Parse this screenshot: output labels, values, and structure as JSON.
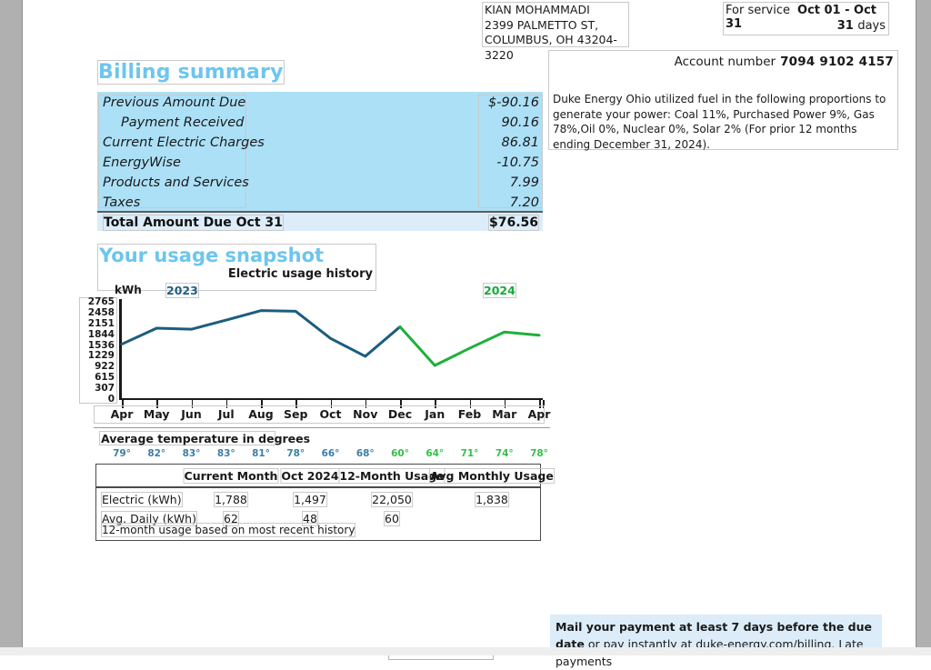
{
  "customer": {
    "name": "KIAN MOHAMMADI",
    "street": "2399 PALMETTO ST,",
    "city_state_zip": "COLUMBUS, OH 43204-3220"
  },
  "service": {
    "label": "For service",
    "period": "Oct 01 - Oct 31",
    "days": "31",
    "days_label": "days"
  },
  "account": {
    "label": "Account number",
    "number": "7094 9102 4157",
    "fuel_mix_text": "Duke Energy Ohio utilized fuel in the following proportions to generate your power: Coal 11%, Purchased Power 9%, Gas 78%,Oil 0%, Nuclear 0%, Solar 2% (For prior 12 months ending December 31, 2024)."
  },
  "billing_summary": {
    "title": "Billing summary",
    "rows": [
      {
        "label": "Previous Amount Due",
        "amount": "$-90.16",
        "indent": false
      },
      {
        "label": "Payment Received",
        "amount": "90.16",
        "indent": true
      },
      {
        "label": "Current Electric Charges",
        "amount": "86.81",
        "indent": false
      },
      {
        "label": "EnergyWise",
        "amount": "-10.75",
        "indent": false
      },
      {
        "label": "Products and Services",
        "amount": "7.99",
        "indent": false
      },
      {
        "label": "Taxes",
        "amount": "7.20",
        "indent": false
      }
    ],
    "total_label": "Total Amount Due Oct 31",
    "total_amount": "$76.56",
    "band_color": "#ace0f7",
    "total_color": "#dcedf9",
    "heading_color": "#6cc6ee"
  },
  "usage_snapshot": {
    "title": "Your usage snapshot",
    "subtitle": "Electric usage history",
    "unit_label": "kWh",
    "legend": [
      {
        "label": "2023",
        "color": "#1f5f86"
      },
      {
        "label": "2024",
        "color": "#19a83a"
      }
    ],
    "temperature_title": "Average temperature in degrees",
    "temperatures": [
      {
        "value": "79°",
        "year": "2023"
      },
      {
        "value": "82°",
        "year": "2023"
      },
      {
        "value": "83°",
        "year": "2023"
      },
      {
        "value": "83°",
        "year": "2023"
      },
      {
        "value": "81°",
        "year": "2023"
      },
      {
        "value": "78°",
        "year": "2023"
      },
      {
        "value": "66°",
        "year": "2023"
      },
      {
        "value": "68°",
        "year": "2023"
      },
      {
        "value": "60°",
        "year": "2024"
      },
      {
        "value": "64°",
        "year": "2024"
      },
      {
        "value": "71°",
        "year": "2024"
      },
      {
        "value": "74°",
        "year": "2024"
      },
      {
        "value": "78°",
        "year": "2024"
      }
    ]
  },
  "usage_table": {
    "headers": [
      "",
      "Current Month",
      "Oct 2024",
      "12-Month Usage",
      "Avg Monthly Usage"
    ],
    "rows": [
      {
        "label": "Electric (kWh)",
        "current_month": "1,788",
        "prior_year": "1,497",
        "twelve_month": "22,050",
        "avg_monthly": "1,838"
      },
      {
        "label": "Avg. Daily (kWh)",
        "current_month": "62",
        "prior_year": "48",
        "twelve_month": "60",
        "avg_monthly": ""
      }
    ],
    "footnote": "12-month usage based on most recent history"
  },
  "footer_message": {
    "bold_part": "Mail your payment at least 7 days before the due date",
    "rest_part": " or pay instantly at duke-energy.com/billing. Late payments"
  },
  "chart_data": {
    "type": "line",
    "title": "Electric usage history",
    "xlabel": "",
    "ylabel": "kWh",
    "ylim": [
      0,
      2765
    ],
    "grid": false,
    "legend_position": "top",
    "categories": [
      "Apr",
      "May",
      "Jun",
      "Jul",
      "Aug",
      "Sep",
      "Oct",
      "Nov",
      "Dec",
      "Jan",
      "Feb",
      "Mar",
      "Apr"
    ],
    "ytick_labels": [
      "0",
      "307",
      "615",
      "922",
      "1229",
      "1536",
      "1844",
      "2151",
      "2458",
      "2765"
    ],
    "ytick_values": [
      0,
      307,
      615,
      922,
      1229,
      1536,
      1844,
      2151,
      2458,
      2765
    ],
    "series": [
      {
        "name": "2023",
        "color": "#1b5d7e",
        "x": [
          "Apr",
          "May",
          "Jun",
          "Jul",
          "Aug",
          "Sep",
          "Oct",
          "Nov",
          "Dec"
        ],
        "values": [
          1536,
          1990,
          1960,
          2220,
          2490,
          2470,
          1700,
          1190,
          2030
        ]
      },
      {
        "name": "2024",
        "color": "#1fb03a",
        "x": [
          "Dec",
          "Jan",
          "Feb",
          "Mar",
          "Apr"
        ],
        "values": [
          2030,
          930,
          1420,
          1880,
          1790
        ]
      }
    ]
  }
}
